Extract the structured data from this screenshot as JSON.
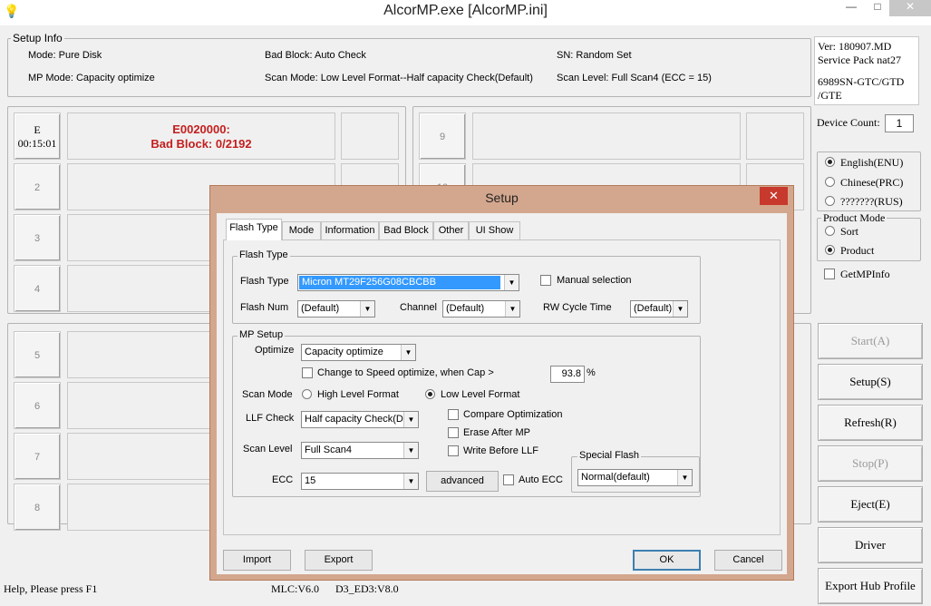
{
  "window": {
    "title": "AlcorMP.exe [AlcorMP.ini]",
    "minimize": "—",
    "maximize": "□",
    "close": "✕"
  },
  "setup_info": {
    "title": "Setup Info",
    "mode": "Mode: Pure Disk",
    "bad_block": "Bad Block: Auto Check",
    "sn": "SN: Random Set",
    "mp_mode": "MP Mode: Capacity optimize",
    "scan_mode": "Scan Mode: Low Level Format--Half capacity Check(Default)",
    "scan_level": "Scan Level: Full Scan4 (ECC = 15)"
  },
  "version": {
    "ver": "Ver: 180907.MD",
    "sp": "Service Pack nat27",
    "chip": "6989SN-GTC/GTD",
    "chip2": "/GTE"
  },
  "device_count": {
    "label": "Device Count:",
    "value": "1"
  },
  "language": {
    "options": [
      "English(ENU)",
      "Chinese(PRC)",
      "???????(RUS)"
    ],
    "selected": 0
  },
  "product_mode": {
    "title": "Product Mode",
    "options": [
      "Sort",
      "Product"
    ],
    "selected": 1
  },
  "get_mp_info": "GetMPInfo",
  "ports": {
    "p1": {
      "label": "E",
      "time": "00:15:01",
      "error_code": "E0020000:",
      "error_msg": "Bad Block: 0/2192"
    },
    "p2": "2",
    "p3": "3",
    "p4": "4",
    "p5": "5",
    "p6": "6",
    "p7": "7",
    "p8": "8",
    "p9": "9",
    "p10": "10"
  },
  "right_buttons": {
    "start": "Start(A)",
    "setup": "Setup(S)",
    "refresh": "Refresh(R)",
    "stop": "Stop(P)",
    "eject": "Eject(E)",
    "driver": "Driver",
    "export_hub": "Export Hub Profile"
  },
  "status_bar": {
    "help": "Help, Please press F1",
    "mlc": "MLC:V6.0",
    "d3": "D3_ED3:V8.0"
  },
  "dialog": {
    "title": "Setup",
    "close": "✕",
    "tabs": [
      "Flash Type",
      "Mode",
      "Information",
      "Bad Block",
      "Other",
      "UI Show"
    ],
    "flash_type_group": "Flash Type",
    "flash_type_label": "Flash Type",
    "flash_type_value": "Micron MT29F256G08CBCBB",
    "manual_selection": "Manual selection",
    "flash_num_label": "Flash Num",
    "flash_num_value": "(Default)",
    "channel_label": "Channel",
    "channel_value": "(Default)",
    "rw_cycle_label": "RW Cycle Time",
    "rw_cycle_value": "(Default)",
    "mp_setup_group": "MP Setup",
    "optimize_label": "Optimize",
    "optimize_value": "Capacity optimize",
    "change_speed": "Change to Speed optimize, when Cap  >",
    "cap_value": "93.8",
    "percent": "%",
    "scan_mode_label": "Scan Mode",
    "high_level": "High Level Format",
    "low_level": "Low Level Format",
    "llf_check_label": "LLF Check",
    "llf_check_value": "Half capacity Check(D",
    "compare_opt": "Compare Optimization",
    "erase_after": "Erase After MP",
    "write_before": "Write Before LLF",
    "scan_level_label": "Scan Level",
    "scan_level_value": "Full Scan4",
    "special_flash_group": "Special Flash",
    "special_flash_value": "Normal(default)",
    "ecc_label": "ECC",
    "ecc_value": "15",
    "advanced": "advanced",
    "auto_ecc": "Auto ECC",
    "import": "Import",
    "export": "Export",
    "ok": "OK",
    "cancel": "Cancel"
  }
}
